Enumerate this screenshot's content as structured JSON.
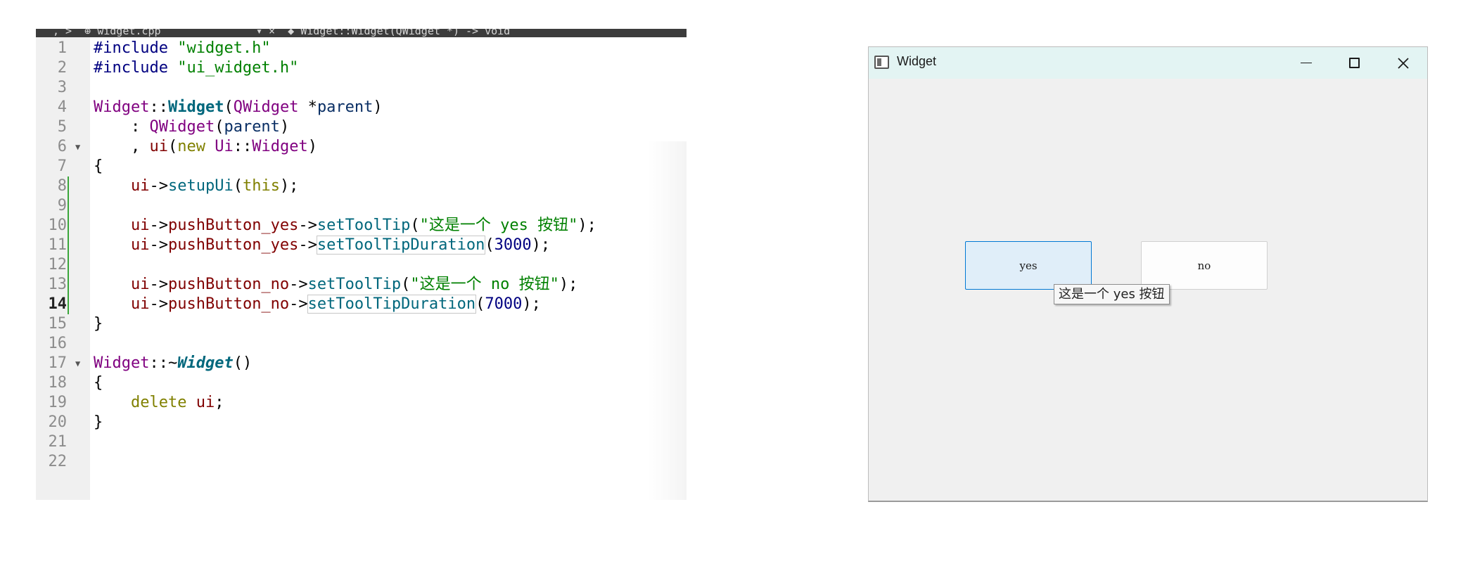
{
  "editor": {
    "topbar_text": ", >  ⊕ widget.cpp               ▾ ×  ◆ Widget::Widget(QWidget *) -> void",
    "current_line": 14,
    "lines": [
      {
        "n": "1",
        "tokens": [
          {
            "t": "#include ",
            "c": "pre"
          },
          {
            "t": "\"widget.h\"",
            "c": "str"
          }
        ]
      },
      {
        "n": "2",
        "tokens": [
          {
            "t": "#include ",
            "c": "pre"
          },
          {
            "t": "\"ui_widget.h\"",
            "c": "str"
          }
        ]
      },
      {
        "n": "3",
        "tokens": []
      },
      {
        "n": "4",
        "tokens": [
          {
            "t": "Widget",
            "c": "cls"
          },
          {
            "t": "::"
          },
          {
            "t": "Widget",
            "c": "fn"
          },
          {
            "t": "("
          },
          {
            "t": "QWidget",
            "c": "cls"
          },
          {
            "t": " *"
          },
          {
            "t": "parent",
            "c": "par"
          },
          {
            "t": ")"
          }
        ]
      },
      {
        "n": "5",
        "tokens": [
          {
            "t": "    : "
          },
          {
            "t": "QWidget",
            "c": "cls"
          },
          {
            "t": "("
          },
          {
            "t": "parent",
            "c": "par"
          },
          {
            "t": ")"
          }
        ]
      },
      {
        "n": "6",
        "fold": true,
        "tokens": [
          {
            "t": "    , "
          },
          {
            "t": "ui",
            "c": "mem"
          },
          {
            "t": "("
          },
          {
            "t": "new ",
            "c": "kw"
          },
          {
            "t": "Ui",
            "c": "cls"
          },
          {
            "t": "::"
          },
          {
            "t": "Widget",
            "c": "cls"
          },
          {
            "t": ")"
          }
        ]
      },
      {
        "n": "7",
        "tokens": [
          {
            "t": "{"
          }
        ]
      },
      {
        "n": "8",
        "mod": true,
        "tokens": [
          {
            "t": "    "
          },
          {
            "t": "ui",
            "c": "mem"
          },
          {
            "t": "->"
          },
          {
            "t": "setupUi",
            "c": "call"
          },
          {
            "t": "("
          },
          {
            "t": "this",
            "c": "kw"
          },
          {
            "t": ");"
          }
        ]
      },
      {
        "n": "9",
        "mod": true,
        "tokens": []
      },
      {
        "n": "10",
        "mod": true,
        "tokens": [
          {
            "t": "    "
          },
          {
            "t": "ui",
            "c": "mem"
          },
          {
            "t": "->"
          },
          {
            "t": "pushButton_yes",
            "c": "mem"
          },
          {
            "t": "->"
          },
          {
            "t": "setToolTip",
            "c": "call"
          },
          {
            "t": "("
          },
          {
            "t": "\"这是一个 yes 按钮\"",
            "c": "str"
          },
          {
            "t": ");"
          }
        ]
      },
      {
        "n": "11",
        "mod": true,
        "tokens": [
          {
            "t": "    "
          },
          {
            "t": "ui",
            "c": "mem"
          },
          {
            "t": "->"
          },
          {
            "t": "pushButton_yes",
            "c": "mem"
          },
          {
            "t": "->"
          },
          {
            "t": "setToolTipDuration",
            "c": "call box"
          },
          {
            "t": "("
          },
          {
            "t": "3000",
            "c": "num"
          },
          {
            "t": ");"
          }
        ]
      },
      {
        "n": "12",
        "mod": true,
        "tokens": []
      },
      {
        "n": "13",
        "mod": true,
        "tokens": [
          {
            "t": "    "
          },
          {
            "t": "ui",
            "c": "mem"
          },
          {
            "t": "->"
          },
          {
            "t": "pushButton_no",
            "c": "mem"
          },
          {
            "t": "->"
          },
          {
            "t": "setToolTip",
            "c": "call"
          },
          {
            "t": "("
          },
          {
            "t": "\"这是一个 no 按钮\"",
            "c": "str"
          },
          {
            "t": ");"
          }
        ]
      },
      {
        "n": "14",
        "mod": true,
        "tokens": [
          {
            "t": "    "
          },
          {
            "t": "ui",
            "c": "mem"
          },
          {
            "t": "->"
          },
          {
            "t": "pushButton_no",
            "c": "mem"
          },
          {
            "t": "->"
          },
          {
            "t": "setToolTipDuration",
            "c": "call box"
          },
          {
            "t": "("
          },
          {
            "t": "7000",
            "c": "num"
          },
          {
            "t": ");"
          }
        ]
      },
      {
        "n": "15",
        "tokens": [
          {
            "t": "}"
          }
        ]
      },
      {
        "n": "16",
        "tokens": []
      },
      {
        "n": "17",
        "fold": true,
        "tokens": [
          {
            "t": "Widget",
            "c": "cls"
          },
          {
            "t": "::~"
          },
          {
            "t": "Widget",
            "c": "fni"
          },
          {
            "t": "()"
          }
        ]
      },
      {
        "n": "18",
        "tokens": [
          {
            "t": "{"
          }
        ]
      },
      {
        "n": "19",
        "tokens": [
          {
            "t": "    "
          },
          {
            "t": "delete ",
            "c": "kw"
          },
          {
            "t": "ui",
            "c": "mem"
          },
          {
            "t": ";"
          }
        ]
      },
      {
        "n": "20",
        "tokens": [
          {
            "t": "}"
          }
        ]
      },
      {
        "n": "21",
        "tokens": []
      },
      {
        "n": "22",
        "tokens": []
      }
    ]
  },
  "window": {
    "title": "Widget",
    "app_icon": "window-app-icon",
    "controls": [
      "minimize-icon",
      "maximize-icon",
      "close-icon"
    ],
    "buttons": {
      "yes": "yes",
      "no": "no"
    },
    "tooltip": "这是一个 yes 按钮"
  }
}
